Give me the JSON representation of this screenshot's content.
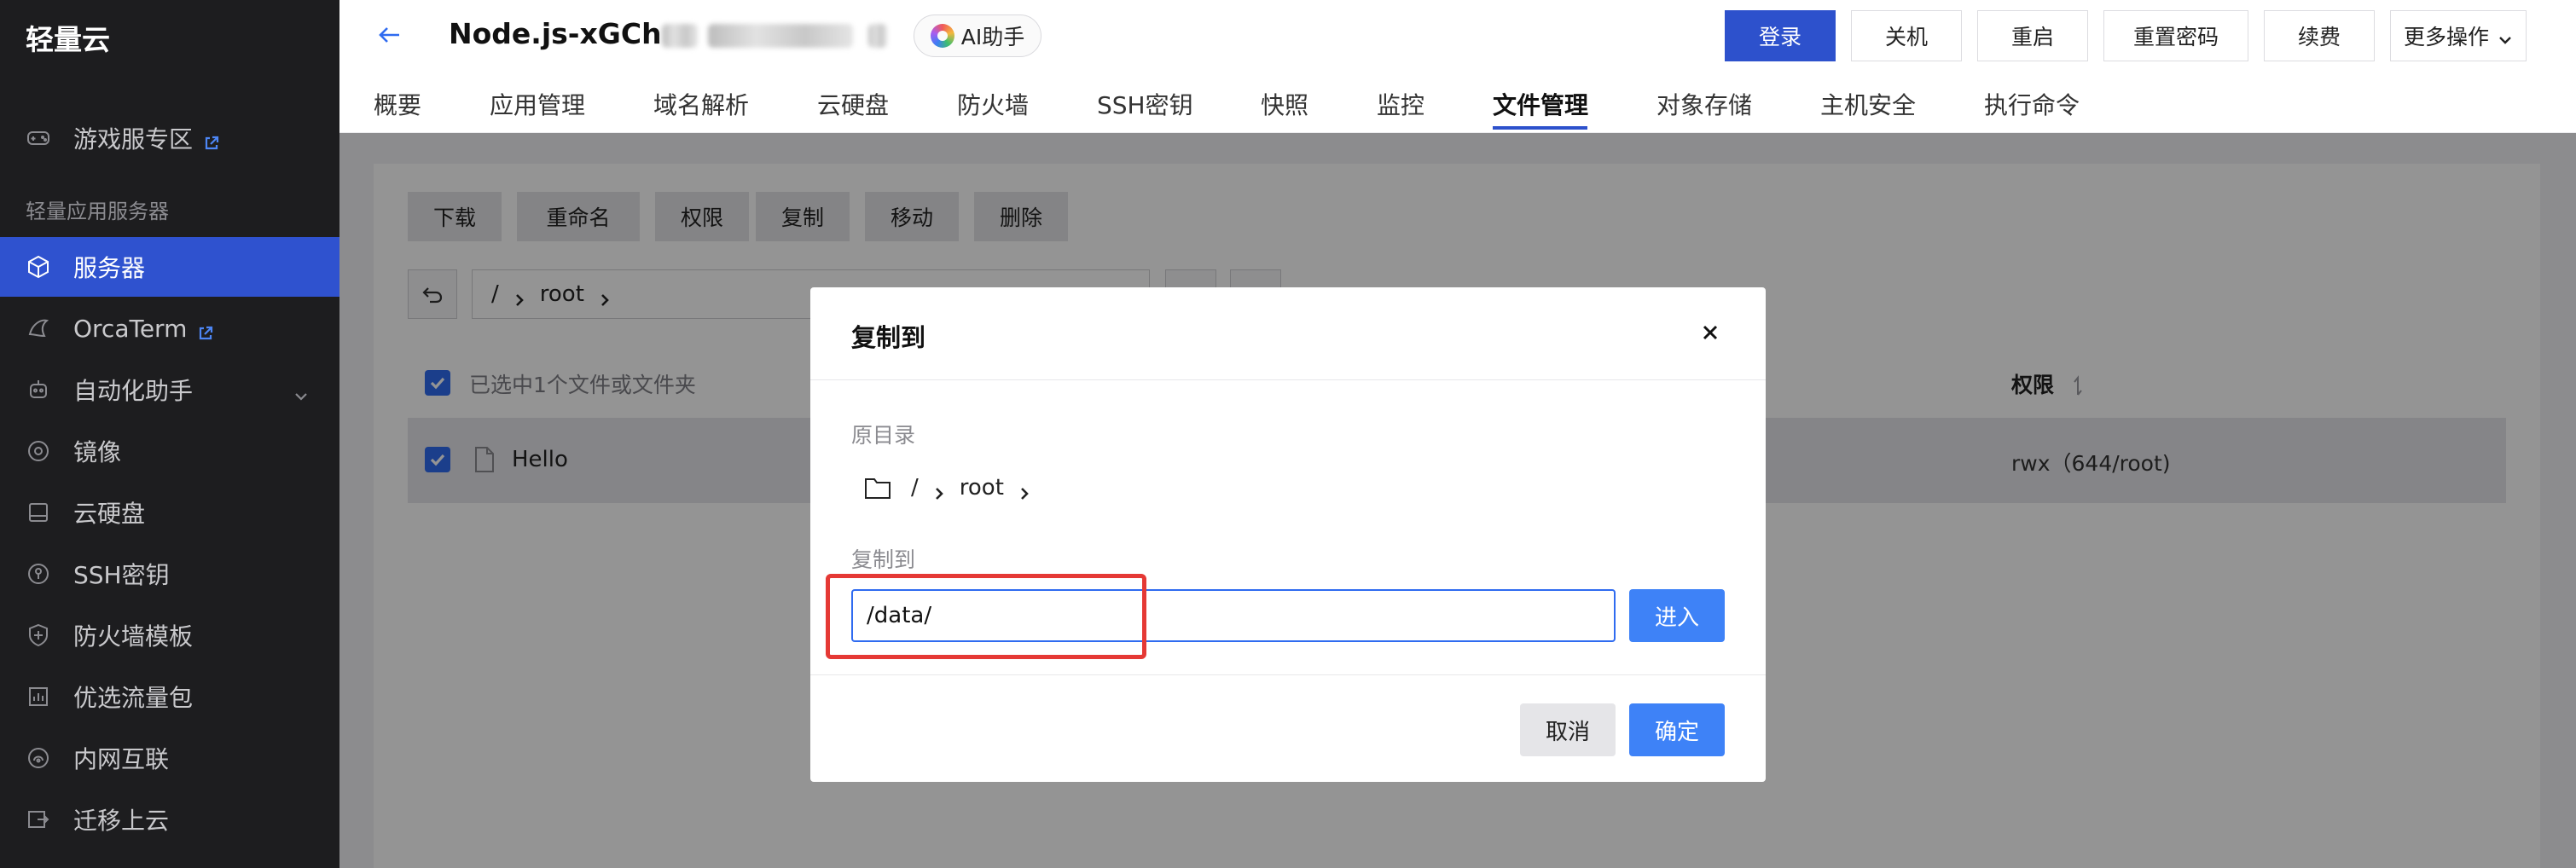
{
  "sidebar": {
    "logo": "轻量云",
    "game_zone": "游戏服专区",
    "group_label": "轻量应用服务器",
    "items": [
      {
        "label": "服务器"
      },
      {
        "label": "OrcaTerm"
      },
      {
        "label": "自动化助手"
      },
      {
        "label": "镜像"
      },
      {
        "label": "云硬盘"
      },
      {
        "label": "SSH密钥"
      },
      {
        "label": "防火墙模板"
      },
      {
        "label": "优选流量包"
      },
      {
        "label": "内网互联"
      },
      {
        "label": "迁移上云"
      }
    ]
  },
  "header": {
    "title": "Node.js-xGCh",
    "ai_label": "AI助手",
    "buttons": {
      "login": "登录",
      "shutdown": "关机",
      "restart": "重启",
      "reset_password": "重置密码",
      "renew": "续费",
      "more": "更多操作"
    },
    "tabs": [
      "概要",
      "应用管理",
      "域名解析",
      "云硬盘",
      "防火墙",
      "SSH密钥",
      "快照",
      "监控",
      "文件管理",
      "对象存储",
      "主机安全",
      "执行命令"
    ],
    "active_tab": "文件管理"
  },
  "file_manager": {
    "toolbar": [
      "下载",
      "重命名",
      "权限",
      "复制",
      "移动",
      "删除"
    ],
    "path": [
      "/",
      "root"
    ],
    "selection_text": "已选中1个文件或文件夹",
    "perm_header": "权限",
    "rows": [
      {
        "name": "Hello",
        "permission": "rwx（644/root)"
      }
    ]
  },
  "modal": {
    "title": "复制到",
    "source_label": "原目录",
    "source_path": [
      "/",
      "root"
    ],
    "target_label": "复制到",
    "target_value": "/data/",
    "enter_label": "进入",
    "cancel_label": "取消",
    "ok_label": "确定"
  },
  "colors": {
    "sidebar_bg": "#1d1d1f",
    "sidebar_active": "#2f52cf",
    "primary": "#2d51cc",
    "accent_blue": "#3e82f7",
    "highlight_red": "#e53935"
  }
}
